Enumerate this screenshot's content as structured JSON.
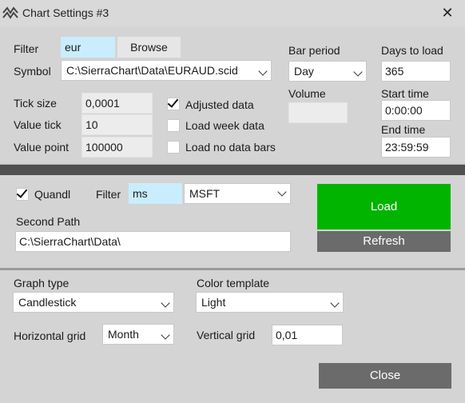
{
  "window": {
    "title": "Chart Settings #3",
    "close_label": "✕"
  },
  "top": {
    "filter_label": "Filter",
    "filter_value": "eur",
    "browse_label": "Browse",
    "symbol_label": "Symbol",
    "symbol_value": "C:\\SierraChart\\Data\\EURAUD.scid",
    "tick_size_label": "Tick size",
    "tick_size_value": "0,0001",
    "value_tick_label": "Value tick",
    "value_tick_value": "10",
    "value_point_label": "Value point",
    "value_point_value": "100000",
    "adjusted_data_label": "Adjusted data",
    "adjusted_data_checked": true,
    "load_week_label": "Load week data",
    "load_week_checked": false,
    "load_no_bars_label": "Load no data bars",
    "load_no_bars_checked": false,
    "bar_period_label": "Bar period",
    "bar_period_value": "Day",
    "volume_label": "Volume",
    "volume_value": "",
    "days_to_load_label": "Days to load",
    "days_to_load_value": "365",
    "start_time_label": "Start time",
    "start_time_value": "0:00:00",
    "end_time_label": "End time",
    "end_time_value": "23:59:59"
  },
  "mid": {
    "quandl_label": "Quandl",
    "quandl_checked": true,
    "filter_label": "Filter",
    "filter_value": "ms",
    "symbol_select_value": "MSFT",
    "second_path_label": "Second Path",
    "second_path_value": "C:\\SierraChart\\Data\\",
    "load_label": "Load",
    "refresh_label": "Refresh"
  },
  "bottom": {
    "graph_type_label": "Graph type",
    "graph_type_value": "Candlestick",
    "color_template_label": "Color template",
    "color_template_value": "Light",
    "horizontal_grid_label": "Horizontal grid",
    "horizontal_grid_value": "Month",
    "vertical_grid_label": "Vertical grid",
    "vertical_grid_value": "0,01",
    "close_label": "Close"
  },
  "colors": {
    "load_green": "#00b400",
    "dark_button": "#6b6b6b",
    "cyan_input": "#c9edfd",
    "divider_dark": "#505050"
  },
  "icons": {
    "app": "double-chevron-icon",
    "close": "close-icon",
    "check": "checkmark-icon",
    "dropdown": "chevron-down-icon"
  }
}
